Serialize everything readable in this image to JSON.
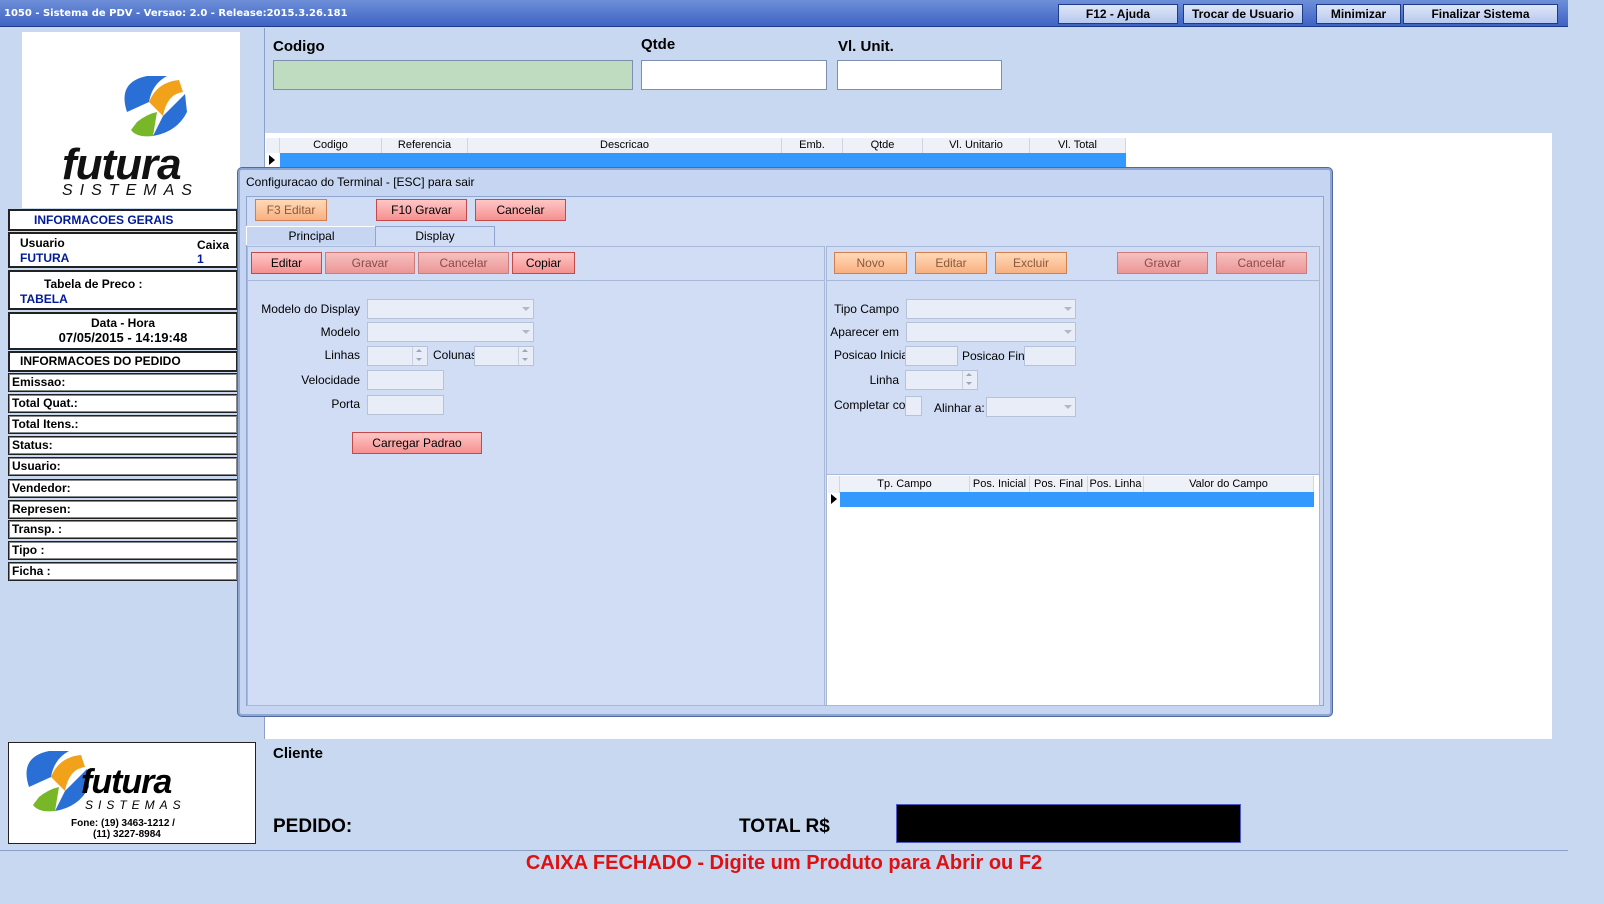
{
  "titlebar": {
    "title": "1050 - Sistema de PDV - Versao: 2.0 - Release:2015.3.26.181",
    "help_button": "F12 - Ajuda",
    "switch_user_button": "Trocar de Usuario",
    "minimize_button": "Minimizar",
    "exit_button": "Finalizar Sistema"
  },
  "left": {
    "logo_text": "futura",
    "logo_sub": "SISTEMAS",
    "general_info_header": "INFORMACOES GERAIS",
    "user_label": "Usuario",
    "user_value": "FUTURA",
    "caixa_label": "Caixa",
    "caixa_value": "1",
    "price_table_label": "Tabela de Preco :",
    "price_table_value": "TABELA",
    "datetime_label": "Data - Hora",
    "datetime_value": "07/05/2015 - 14:19:48",
    "order_info_header": "INFORMACOES DO PEDIDO",
    "order_rows": [
      "Emissao:",
      "Total Quat.:",
      "Total Itens.:",
      "Status:",
      "Usuario:",
      "Vendedor:",
      "Represen:",
      "Transp. :",
      "Tipo :",
      "Ficha :"
    ],
    "footer_logo_text": "futura",
    "footer_logo_sub": "SISTEMAS",
    "footer_phone1": "Fone: (19) 3463-1212 /",
    "footer_phone2": "(11) 3227-8984"
  },
  "main": {
    "codigo_label": "Codigo",
    "qtde_label": "Qtde",
    "vlunit_label": "Vl. Unit.",
    "codigo_value": "",
    "qtde_value": "",
    "vlunit_value": "",
    "grid_headers": [
      "Codigo",
      "Referencia",
      "Descricao",
      "Emb.",
      "Qtde",
      "Vl. Unitario",
      "Vl. Total"
    ],
    "cliente_label": "Cliente",
    "pedido_label": "PEDIDO:",
    "total_label": "TOTAL R$",
    "total_value": ""
  },
  "status": {
    "message": "CAIXA FECHADO - Digite um Produto para Abrir ou F2",
    "color": "#e01010"
  },
  "dialog": {
    "title": "Configuracao do Terminal - [ESC] para sair",
    "f3_button": "F3 Editar",
    "f10_button": "F10 Gravar",
    "cancel_button": "Cancelar",
    "tabs": [
      "Principal",
      "Display"
    ],
    "active_tab": "Display",
    "left": {
      "edit_button": "Editar",
      "save_button": "Gravar",
      "cancel_button": "Cancelar",
      "copy_button": "Copiar",
      "display_model_label": "Modelo do Display",
      "model_label": "Modelo",
      "lines_label": "Linhas",
      "columns_label": "Colunas",
      "speed_label": "Velocidade",
      "port_label": "Porta",
      "load_default_button": "Carregar Padrao"
    },
    "right": {
      "new_button": "Novo",
      "edit_button": "Editar",
      "delete_button": "Excluir",
      "save_button": "Gravar",
      "cancel_button": "Cancelar",
      "field_type_label": "Tipo Campo",
      "appear_in_label": "Aparecer em",
      "start_pos_label": "Posicao Inicial",
      "end_pos_label": "Posicao Final",
      "line_label": "Linha",
      "complete_with_label": "Completar com",
      "align_label": "Alinhar a:",
      "grid_headers": [
        "Tp. Campo",
        "Pos. Inicial",
        "Pos. Final",
        "Pos. Linha",
        "Valor do Campo"
      ]
    }
  },
  "colors": {
    "titlebar": "#3d63c4",
    "panel_bg": "#c8d8f0",
    "selection_blue": "#3399ff",
    "codigo_field": "#c0dcc0"
  }
}
